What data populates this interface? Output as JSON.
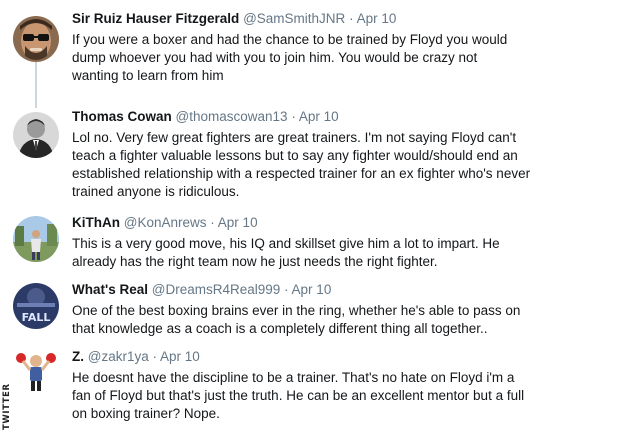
{
  "watermark": "TWITTER",
  "tweets": [
    {
      "name": "Sir Ruiz Hauser Fitzgerald",
      "handle": "@SamSmithJNR",
      "separator": "·",
      "date": "Apr 10",
      "lines": [
        "If you were a boxer and had the chance to be trained by Floyd you would",
        "dump whoever you had with you to join him. You would be crazy not",
        "wanting to learn from him"
      ]
    },
    {
      "name": "Thomas Cowan",
      "handle": "@thomascowan13",
      "separator": "·",
      "date": "Apr 10",
      "lines": [
        "Lol no. Very few great fighters are great trainers. I'm not saying Floyd can't",
        "teach a fighter valuable lessons but to say any fighter would/should end an",
        "established relationship with a respected trainer for an ex fighter who's never",
        "trained anyone is ridiculous."
      ]
    },
    {
      "name": "KiThAn",
      "handle": "@KonAnrews",
      "separator": "·",
      "date": "Apr 10",
      "lines": [
        "This is a very good move, his IQ and skillset give him a lot to impart. He",
        "already has the right team now he just needs the right fighter."
      ]
    },
    {
      "name": "What's Real",
      "handle": "@DreamsR4Real999",
      "separator": "·",
      "date": "Apr 10",
      "avatar_text": "FALL",
      "lines": [
        "One of the best boxing brains ever in the ring, whether he's able to pass on",
        "that knowledge as a coach is a completely different thing all together.."
      ]
    },
    {
      "name": "Z.",
      "handle": "@zakr1ya",
      "separator": "·",
      "date": "Apr 10",
      "lines": [
        "He doesnt have the discipline to be a trainer. That's no hate on Floyd i'm a",
        "fan of Floyd but that's just the truth. He can be an excellent mentor but a full",
        "on boxing trainer? Nope."
      ]
    }
  ]
}
